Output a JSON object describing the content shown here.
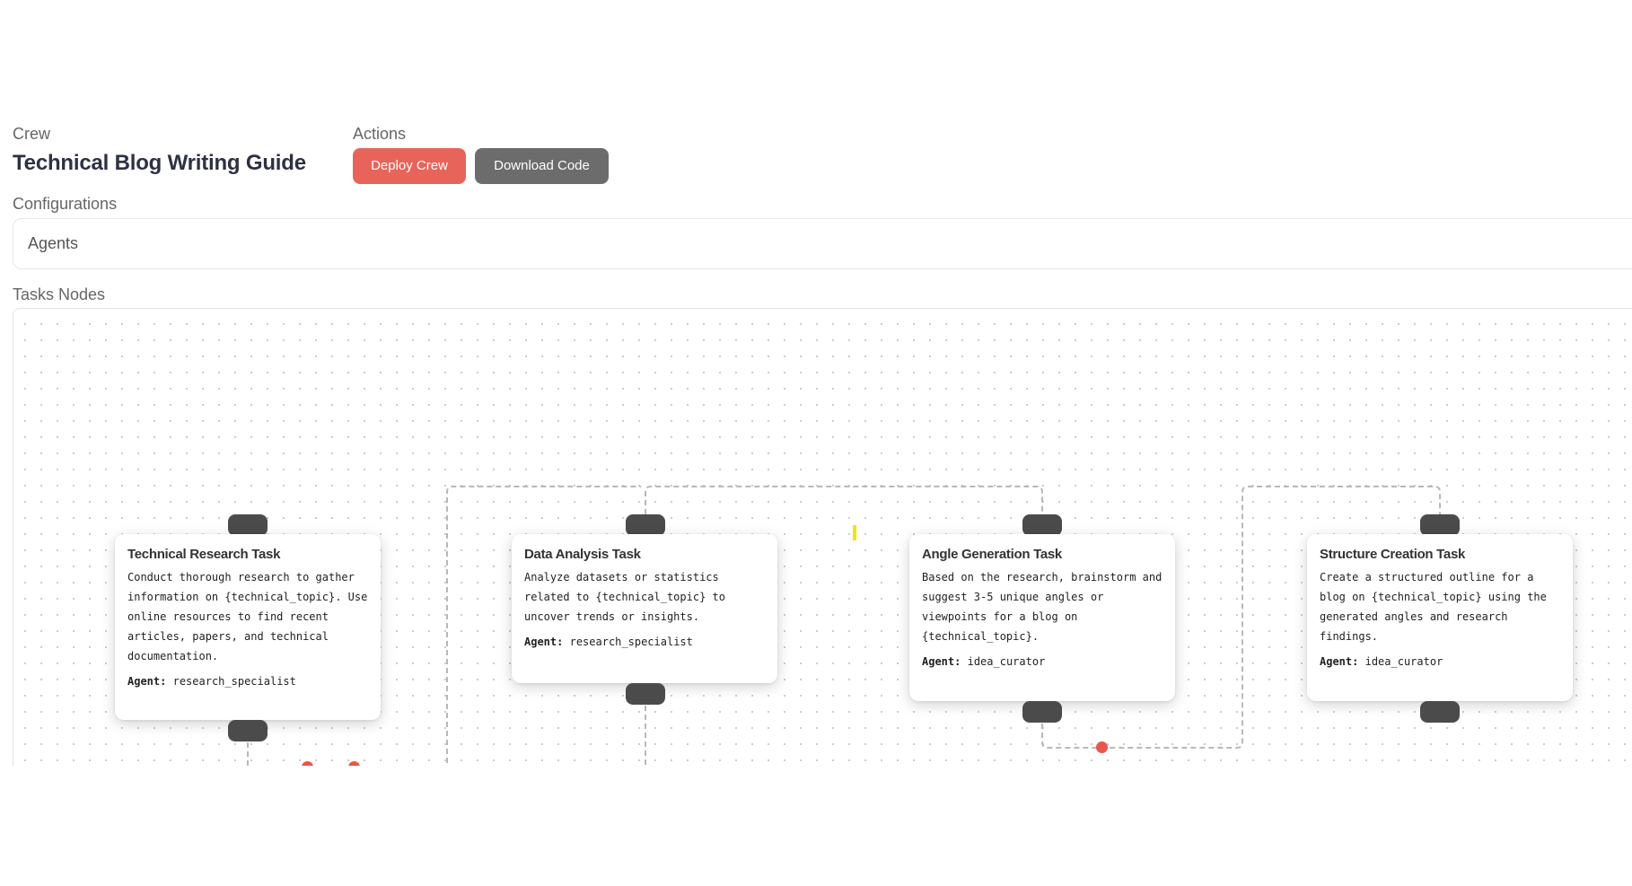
{
  "header": {
    "crew_label": "Crew",
    "crew_title": "Technical Blog Writing Guide",
    "actions_label": "Actions",
    "deploy_button": "Deploy Crew",
    "download_button": "Download Code"
  },
  "colors": {
    "deploy": "#e8645a",
    "download": "#6c6c6c",
    "handle": "#4b4b4b",
    "edge_marker": "#e8564d",
    "cursor_marker": "#f2e600"
  },
  "configurations": {
    "label": "Configurations",
    "agents_label": "Agents"
  },
  "tasks": {
    "label": "Tasks Nodes",
    "agent_prefix": "Agent:",
    "nodes": [
      {
        "title": "Technical Research Task",
        "description": "Conduct thorough research to gather information on {technical_topic}. Use online resources to find recent articles, papers, and technical documentation.",
        "agent": "research_specialist"
      },
      {
        "title": "Data Analysis Task",
        "description": "Analyze datasets or statistics related to {technical_topic} to uncover trends or insights.",
        "agent": "research_specialist"
      },
      {
        "title": "Angle Generation Task",
        "description": "Based on the research, brainstorm and suggest 3-5 unique angles or viewpoints for a blog on {technical_topic}.",
        "agent": "idea_curator"
      },
      {
        "title": "Structure Creation Task",
        "description": "Create a structured outline for a blog on {technical_topic} using the generated angles and research findings.",
        "agent": "idea_curator"
      }
    ]
  }
}
